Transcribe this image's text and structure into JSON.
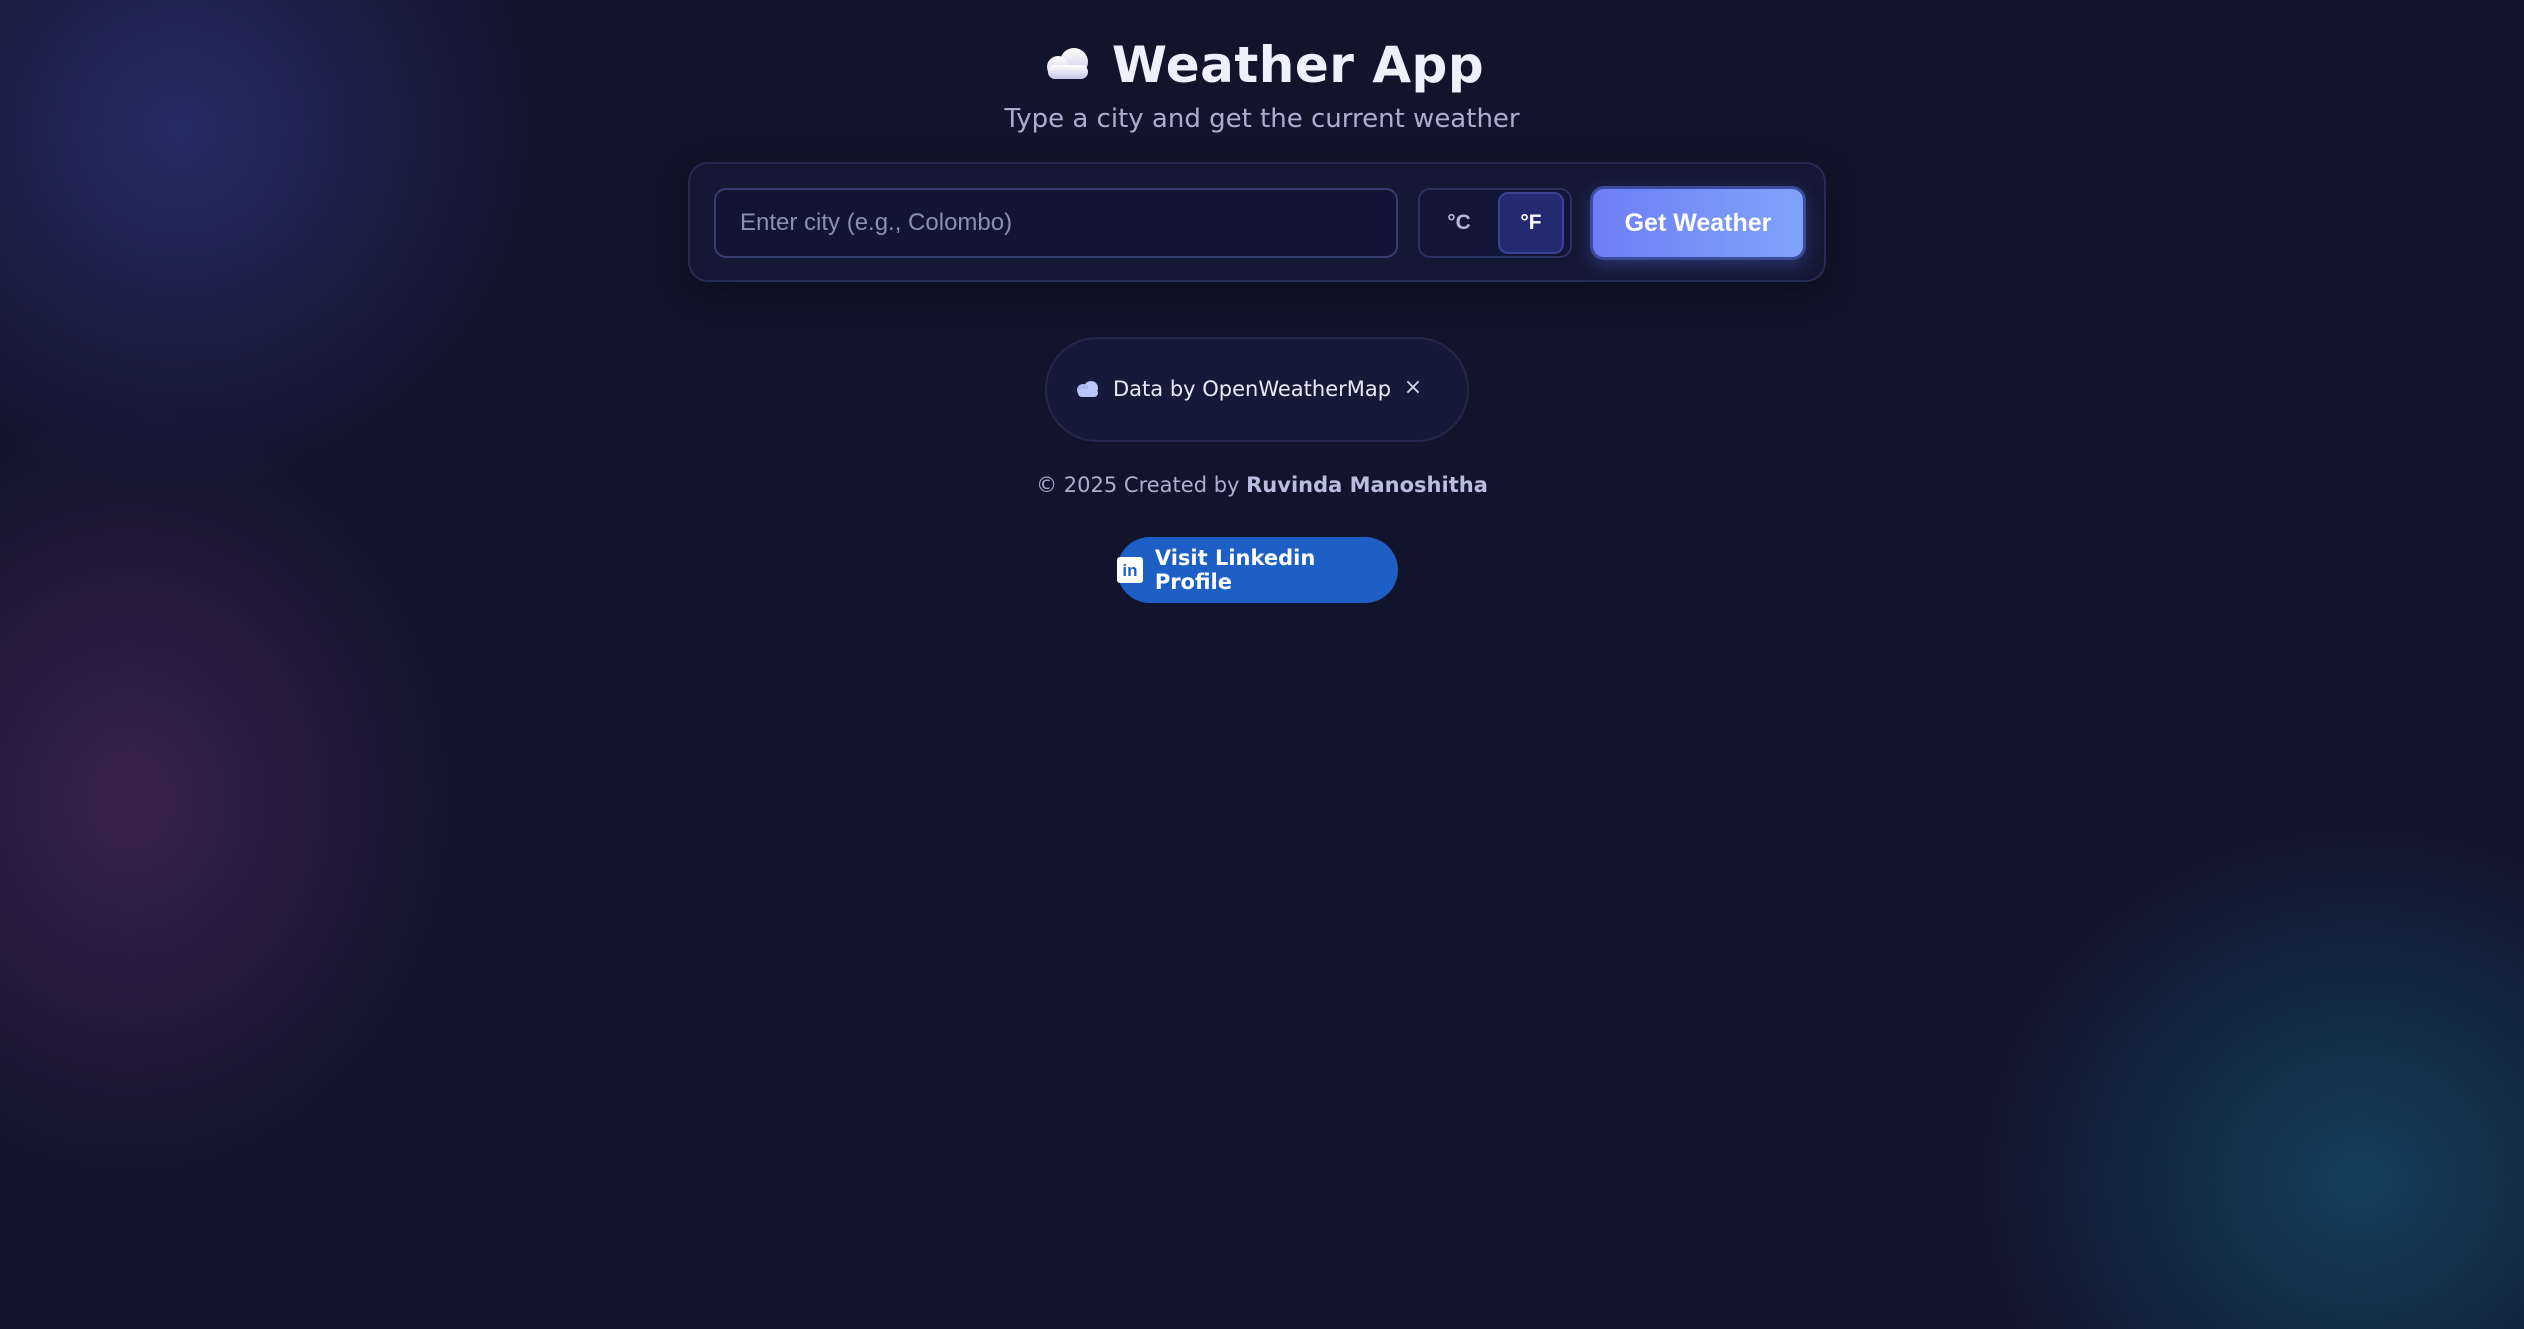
{
  "header": {
    "icon": "cloud-icon",
    "title": "Weather App",
    "subtitle": "Type a city and get the current weather"
  },
  "search": {
    "placeholder": "Enter city (e.g., Colombo)",
    "value": ""
  },
  "units": {
    "celsius_label": "°C",
    "fahrenheit_label": "°F",
    "selected": "°F"
  },
  "actions": {
    "get_weather_label": "Get Weather"
  },
  "attribution": {
    "icon": "cloud-icon",
    "text": "Data by OpenWeatherMap",
    "close_label": "×"
  },
  "footer": {
    "prefix": "© 2025 Created by ",
    "author": "Ruvinda Manoshitha"
  },
  "linkedin": {
    "icon": "linkedin-icon",
    "icon_text": "in",
    "label": "Visit Linkedin Profile"
  },
  "colors": {
    "background": "#12142b",
    "accent": "#6e7ef6",
    "linkedin_blue": "#1d5fc4"
  }
}
